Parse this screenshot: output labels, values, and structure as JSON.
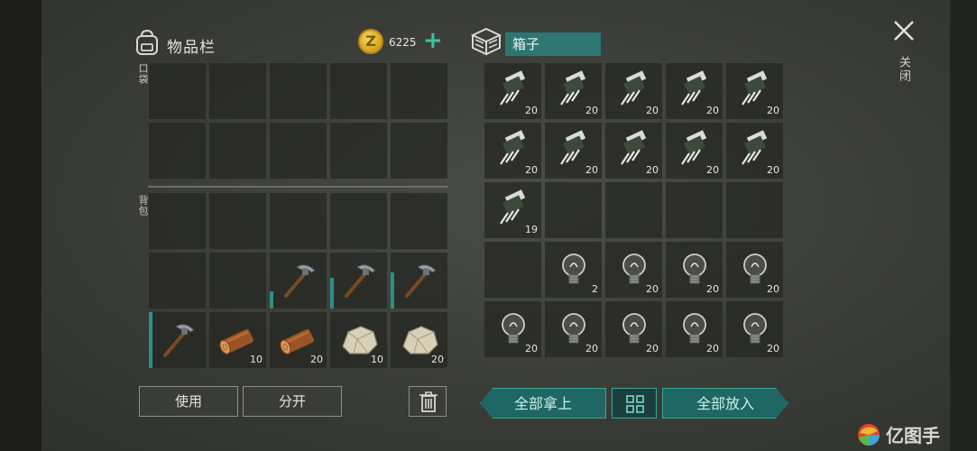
{
  "inventory": {
    "title": "物品栏",
    "pocket_label": "口袋",
    "backpack_label": "背包",
    "coins": "6225",
    "pocket_slots": [
      {},
      {},
      {},
      {},
      {},
      {},
      {},
      {},
      {},
      {}
    ],
    "backpack_slots": [
      {},
      {},
      {},
      {},
      {},
      {},
      {},
      {
        "item": "pickaxe",
        "durability": 0.3
      },
      {
        "item": "pickaxe",
        "durability": 0.55
      },
      {
        "item": "pickaxe",
        "durability": 0.65
      },
      {
        "item": "pickaxe",
        "durability": 1.0
      },
      {
        "item": "log",
        "qty": "10"
      },
      {
        "item": "log",
        "qty": "20"
      },
      {
        "item": "stone",
        "qty": "10"
      },
      {
        "item": "stone",
        "qty": "20"
      }
    ]
  },
  "box": {
    "title": "箱子",
    "slots": [
      {
        "item": "transistor",
        "qty": "20"
      },
      {
        "item": "transistor",
        "qty": "20"
      },
      {
        "item": "transistor",
        "qty": "20"
      },
      {
        "item": "transistor",
        "qty": "20"
      },
      {
        "item": "transistor",
        "qty": "20"
      },
      {
        "item": "transistor",
        "qty": "20"
      },
      {
        "item": "transistor",
        "qty": "20"
      },
      {
        "item": "transistor",
        "qty": "20"
      },
      {
        "item": "transistor",
        "qty": "20"
      },
      {
        "item": "transistor",
        "qty": "20"
      },
      {
        "item": "transistor",
        "qty": "19"
      },
      {},
      {},
      {},
      {},
      {},
      {
        "item": "bulb",
        "qty": "2"
      },
      {
        "item": "bulb",
        "qty": "20"
      },
      {
        "item": "bulb",
        "qty": "20"
      },
      {
        "item": "bulb",
        "qty": "20"
      },
      {
        "item": "bulb",
        "qty": "20"
      },
      {
        "item": "bulb",
        "qty": "20"
      },
      {
        "item": "bulb",
        "qty": "20"
      },
      {
        "item": "bulb",
        "qty": "20"
      },
      {
        "item": "bulb",
        "qty": "20"
      }
    ]
  },
  "buttons": {
    "use": "使用",
    "split": "分开",
    "take_all": "全部拿上",
    "put_all": "全部放入",
    "close": "关闭"
  },
  "watermark": "亿图手",
  "colors": {
    "accent": "#2d7673",
    "durability": "#2e8e89",
    "coin": "#d3a21d"
  }
}
